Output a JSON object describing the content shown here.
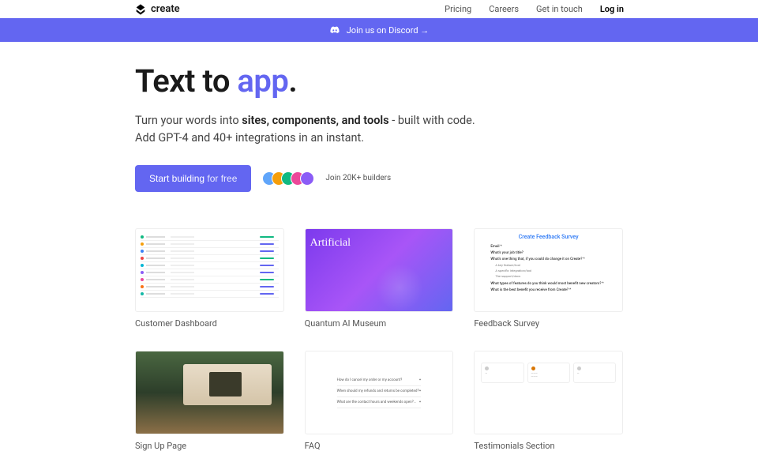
{
  "nav": {
    "logo_text": "create",
    "links": [
      "Pricing",
      "Careers",
      "Get in touch"
    ],
    "login": "Log in"
  },
  "banner": {
    "text": "Join us on Discord →"
  },
  "hero": {
    "title_1": "Text to ",
    "title_2": "app",
    "title_3": ".",
    "sub_1": "Turn your words into ",
    "sub_bold": "sites, components, and tools",
    "sub_2": " - built with code.",
    "sub_3": "Add GPT-4 and 40+ integrations in an instant.",
    "cta_1": "Start building",
    "cta_2": " for free",
    "builders": "Join 20K+ builders",
    "avatar_colors": [
      "#60a5fa",
      "#f59e0b",
      "#10b981",
      "#ec4899",
      "#8b5cf6"
    ]
  },
  "cards": [
    {
      "title": "Customer Dashboard"
    },
    {
      "title": "Quantum AI Museum"
    },
    {
      "title": "Feedback Survey"
    },
    {
      "title": "Sign Up Page"
    },
    {
      "title": "FAQ"
    },
    {
      "title": "Testimonials Section"
    }
  ],
  "feedback_card": {
    "title": "Create Feedback Survey",
    "q1": "Email *",
    "q2": "What's your job title?",
    "q3": "What's one thing that, if you could do change it on Create? *",
    "opts": [
      "A key feature/tool",
      "A specific integration/tool",
      "The support/docs"
    ],
    "q4": "What types of features do you think would most benefit new creators? *",
    "q5": "What is the best benefit you receive from Create? *"
  },
  "museum_card": {
    "text": "Artificial"
  },
  "faq_card": {
    "items": [
      "How do I cancel my order or my account?",
      "When should my refunds and returns be completed?",
      "What are the contact hours and weekends open?..."
    ]
  }
}
